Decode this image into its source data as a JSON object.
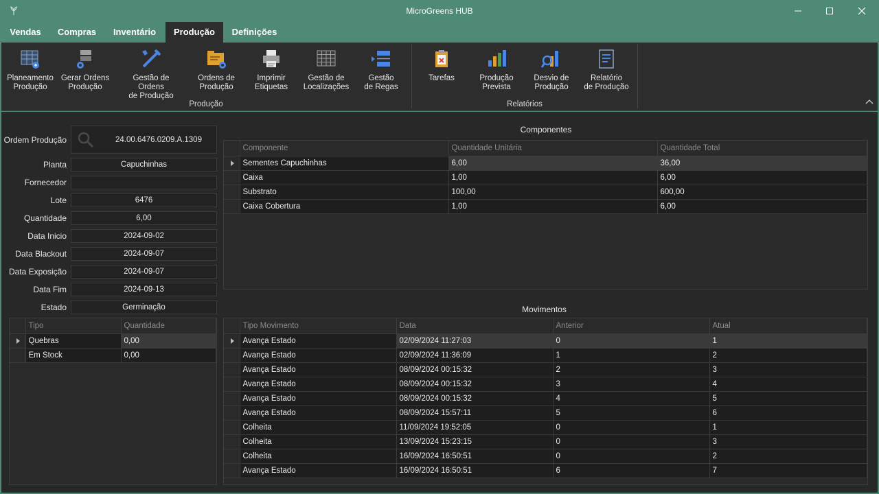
{
  "window": {
    "title": "MicroGreens HUB"
  },
  "menu": {
    "tabs": [
      {
        "label": "Vendas"
      },
      {
        "label": "Compras"
      },
      {
        "label": "Inventário"
      },
      {
        "label": "Produção"
      },
      {
        "label": "Definições"
      }
    ],
    "active_tab": "Produção"
  },
  "ribbon": {
    "groups": [
      {
        "label": "Produção"
      },
      {
        "label": "Relatórios"
      }
    ],
    "buttons": [
      {
        "line1": "Planeamento",
        "line2": "Produção",
        "icon": "planning-grid-icon"
      },
      {
        "line1": "Gerar Ordens",
        "line2": "Produção",
        "icon": "generate-orders-icon"
      },
      {
        "line1": "Gestão de Ordens",
        "line2": "de Produção",
        "icon": "tools-icon"
      },
      {
        "line1": "Ordens de",
        "line2": "Produção",
        "icon": "orders-folder-icon"
      },
      {
        "line1": "Imprimir",
        "line2": "Etiquetas",
        "icon": "printer-icon"
      },
      {
        "line1": "Gestão de",
        "line2": "Localizações",
        "icon": "locations-grid-icon"
      },
      {
        "line1": "Gestão",
        "line2": "de Regas",
        "icon": "watering-list-icon"
      },
      {
        "line1": "Tarefas",
        "line2": "",
        "icon": "clipboard-tasks-icon"
      },
      {
        "line1": "Produção",
        "line2": "Prevista",
        "icon": "forecast-bar-chart-icon"
      },
      {
        "line1": "Desvio de",
        "line2": "Produção",
        "icon": "deviation-chart-icon"
      },
      {
        "line1": "Relatório",
        "line2": "de Produção",
        "icon": "report-document-icon"
      }
    ]
  },
  "form": {
    "ordem_label": "Ordem Produção",
    "ordem_value": "24.00.6476.0209.A.1309",
    "fields": [
      {
        "label": "Planta",
        "value": "Capuchinhas"
      },
      {
        "label": "Fornecedor",
        "value": ""
      },
      {
        "label": "Lote",
        "value": "6476"
      },
      {
        "label": "Quantidade",
        "value": "6,00"
      },
      {
        "label": "Data Inicio",
        "value": "2024-09-02"
      },
      {
        "label": "Data Blackout",
        "value": "2024-09-07"
      },
      {
        "label": "Data Exposição",
        "value": "2024-09-07"
      },
      {
        "label": "Data Fim",
        "value": "2024-09-13"
      },
      {
        "label": "Estado",
        "value": "Germinação"
      }
    ]
  },
  "stock_grid": {
    "columns": [
      "Tipo",
      "Quantidade"
    ],
    "rows": [
      [
        "Quebras",
        "0,00"
      ],
      [
        "Em Stock",
        "0,00"
      ]
    ]
  },
  "componentes": {
    "title": "Componentes",
    "columns": [
      "Componente",
      "Quantidade Unitária",
      "Quantidade Total"
    ],
    "rows": [
      [
        "Sementes Capuchinhas",
        "6,00",
        "36,00"
      ],
      [
        "Caixa",
        "1,00",
        "6,00"
      ],
      [
        "Substrato",
        "100,00",
        "600,00"
      ],
      [
        "Caixa Cobertura",
        "1,00",
        "6,00"
      ]
    ]
  },
  "movimentos": {
    "title": "Movimentos",
    "columns": [
      "Tipo Movimento",
      "Data",
      "Anterior",
      "Atual"
    ],
    "rows": [
      [
        "Avança Estado",
        "02/09/2024 11:27:03",
        "0",
        "1"
      ],
      [
        "Avança Estado",
        "02/09/2024 11:36:09",
        "1",
        "2"
      ],
      [
        "Avança Estado",
        "08/09/2024 00:15:32",
        "2",
        "3"
      ],
      [
        "Avança Estado",
        "08/09/2024 00:15:32",
        "3",
        "4"
      ],
      [
        "Avança Estado",
        "08/09/2024 00:15:32",
        "4",
        "5"
      ],
      [
        "Avança Estado",
        "08/09/2024 15:57:11",
        "5",
        "6"
      ],
      [
        "Colheita",
        "11/09/2024 19:52:05",
        "0",
        "1"
      ],
      [
        "Colheita",
        "13/09/2024 15:23:15",
        "0",
        "3"
      ],
      [
        "Colheita",
        "16/09/2024 16:50:51",
        "0",
        "2"
      ],
      [
        "Avança Estado",
        "16/09/2024 16:50:51",
        "6",
        "7"
      ]
    ]
  },
  "colors": {
    "titlebar": "#4e8a76",
    "ribbon_bg": "#2d2d2d",
    "content_bg": "#282828",
    "cell_bg": "#1e1e1e",
    "selected_row": "#3a3a3a"
  }
}
